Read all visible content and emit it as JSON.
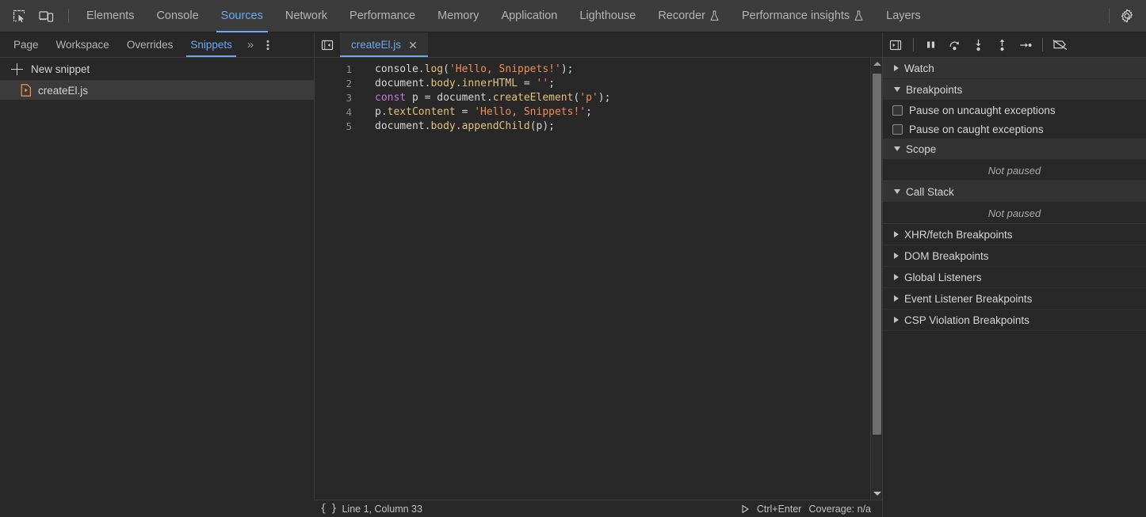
{
  "topbar": {
    "icons": [
      {
        "name": "inspect-element-icon"
      },
      {
        "name": "device-toolbar-icon"
      }
    ],
    "tabs": [
      {
        "label": "Elements",
        "active": false,
        "flask": false
      },
      {
        "label": "Console",
        "active": false,
        "flask": false
      },
      {
        "label": "Sources",
        "active": true,
        "flask": false
      },
      {
        "label": "Network",
        "active": false,
        "flask": false
      },
      {
        "label": "Performance",
        "active": false,
        "flask": false
      },
      {
        "label": "Memory",
        "active": false,
        "flask": false
      },
      {
        "label": "Application",
        "active": false,
        "flask": false
      },
      {
        "label": "Lighthouse",
        "active": false,
        "flask": false
      },
      {
        "label": "Recorder",
        "active": false,
        "flask": true
      },
      {
        "label": "Performance insights",
        "active": false,
        "flask": true
      },
      {
        "label": "Layers",
        "active": false,
        "flask": false
      }
    ],
    "settings_label": "Settings"
  },
  "navigator": {
    "tabs": [
      {
        "label": "Page",
        "active": false
      },
      {
        "label": "Workspace",
        "active": false
      },
      {
        "label": "Overrides",
        "active": false
      },
      {
        "label": "Snippets",
        "active": true
      }
    ],
    "more_label": "»",
    "new_snippet_label": "New snippet",
    "snippets": [
      {
        "name": "createEl.js",
        "selected": true
      }
    ]
  },
  "editor": {
    "tab_label": "createEl.js",
    "close_label": "✕",
    "lines": [
      {
        "number": "1",
        "tokens": [
          {
            "t": "console",
            "c": "plain"
          },
          {
            "t": ".",
            "c": "punct"
          },
          {
            "t": "log",
            "c": "fn"
          },
          {
            "t": "(",
            "c": "punct"
          },
          {
            "t": "'Hello, Snippets!'",
            "c": "str"
          },
          {
            "t": ");",
            "c": "punct"
          }
        ]
      },
      {
        "number": "2",
        "tokens": [
          {
            "t": "document",
            "c": "plain"
          },
          {
            "t": ".",
            "c": "punct"
          },
          {
            "t": "body",
            "c": "prop"
          },
          {
            "t": ".",
            "c": "punct"
          },
          {
            "t": "innerHTML",
            "c": "prop"
          },
          {
            "t": " = ",
            "c": "punct"
          },
          {
            "t": "''",
            "c": "str"
          },
          {
            "t": ";",
            "c": "punct"
          }
        ]
      },
      {
        "number": "3",
        "tokens": [
          {
            "t": "const",
            "c": "kw"
          },
          {
            "t": " p = document",
            "c": "plain"
          },
          {
            "t": ".",
            "c": "punct"
          },
          {
            "t": "createElement",
            "c": "fn"
          },
          {
            "t": "(",
            "c": "punct"
          },
          {
            "t": "'p'",
            "c": "str"
          },
          {
            "t": ");",
            "c": "punct"
          }
        ]
      },
      {
        "number": "4",
        "tokens": [
          {
            "t": "p",
            "c": "plain"
          },
          {
            "t": ".",
            "c": "punct"
          },
          {
            "t": "textContent",
            "c": "prop"
          },
          {
            "t": " = ",
            "c": "punct"
          },
          {
            "t": "'Hello, Snippets!'",
            "c": "str"
          },
          {
            "t": ";",
            "c": "punct"
          }
        ]
      },
      {
        "number": "5",
        "tokens": [
          {
            "t": "document",
            "c": "plain"
          },
          {
            "t": ".",
            "c": "punct"
          },
          {
            "t": "body",
            "c": "prop"
          },
          {
            "t": ".",
            "c": "punct"
          },
          {
            "t": "appendChild",
            "c": "fn"
          },
          {
            "t": "(p);",
            "c": "punct"
          }
        ]
      }
    ]
  },
  "statusbar": {
    "pretty_print_label": "{ }",
    "position": "Line 1, Column 33",
    "run_shortcut": "Ctrl+Enter",
    "coverage": "Coverage: n/a"
  },
  "debugger": {
    "toolbar_buttons": [
      {
        "name": "pause-script-execution-icon"
      },
      {
        "name": "step-over-icon"
      },
      {
        "name": "step-into-icon"
      },
      {
        "name": "step-out-icon"
      },
      {
        "name": "step-icon"
      },
      {
        "name": "deactivate-breakpoints-icon"
      }
    ],
    "sections": [
      {
        "title": "Watch",
        "expanded": false
      },
      {
        "title": "Breakpoints",
        "expanded": true
      },
      {
        "title": "Scope",
        "expanded": true
      },
      {
        "title": "Call Stack",
        "expanded": true
      }
    ],
    "watch_title": "Watch",
    "breakpoints_title": "Breakpoints",
    "pause_uncaught_label": "Pause on uncaught exceptions",
    "pause_uncaught_checked": false,
    "pause_caught_label": "Pause on caught exceptions",
    "pause_caught_checked": false,
    "scope_title": "Scope",
    "scope_empty": "Not paused",
    "callstack_title": "Call Stack",
    "callstack_empty": "Not paused",
    "extra_sections": [
      {
        "title": "XHR/fetch Breakpoints"
      },
      {
        "title": "DOM Breakpoints"
      },
      {
        "title": "Global Listeners"
      },
      {
        "title": "Event Listener Breakpoints"
      },
      {
        "title": "CSP Violation Breakpoints"
      }
    ]
  },
  "colors": {
    "accent": "#6ca8f0",
    "background": "#282828",
    "toolbar": "#3c3c3c",
    "selection": "#3b3b3b",
    "string": "#f28b54",
    "property": "#e5c07b",
    "keyword": "#c678dd",
    "snippet_icon": "#f08c4b"
  }
}
